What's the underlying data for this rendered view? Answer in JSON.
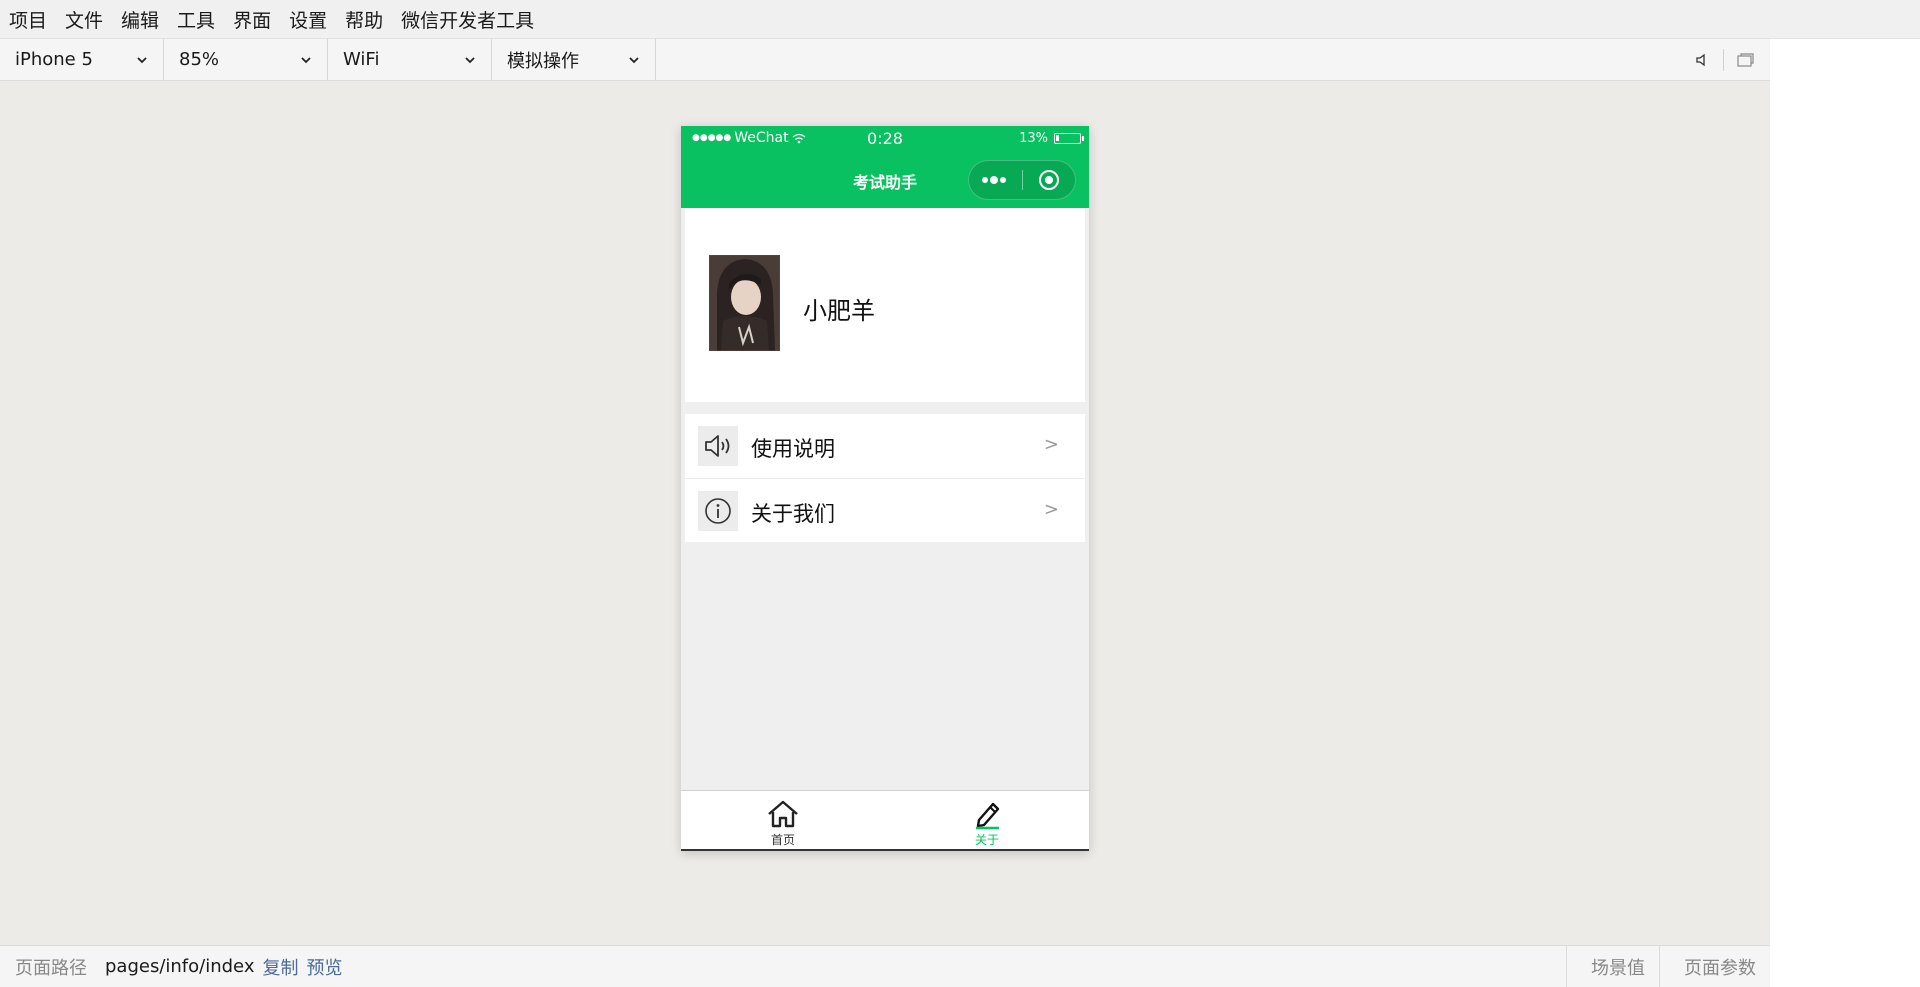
{
  "menubar": {
    "items": [
      "项目",
      "文件",
      "编辑",
      "工具",
      "界面",
      "设置",
      "帮助",
      "微信开发者工具"
    ]
  },
  "toolbar": {
    "device": "iPhone 5",
    "zoom": "85%",
    "network": "WiFi",
    "operation": "模拟操作",
    "icons": [
      "speaker-icon",
      "window-icon"
    ]
  },
  "phone": {
    "statusbar": {
      "signal": "●●●●●",
      "carrier": "WeChat",
      "time": "0:28",
      "battery": "13%",
      "battery_level": 0.13
    },
    "navbar": {
      "title": "考试助手",
      "capsule_icons": [
        "more-dots-icon",
        "close-target-icon"
      ]
    },
    "profile": {
      "username": "小肥羊"
    },
    "list": [
      {
        "icon": "speaker-icon",
        "label": "使用说明",
        "arrow": ">"
      },
      {
        "icon": "info-icon",
        "label": "关于我们",
        "arrow": ">"
      }
    ],
    "tabbar": [
      {
        "icon": "home-icon",
        "label": "首页",
        "active": false
      },
      {
        "icon": "edit-icon",
        "label": "关于",
        "active": true
      }
    ],
    "colors": {
      "brand": "#09c160"
    }
  },
  "pathbar": {
    "label": "页面路径",
    "path": "pages/info/index",
    "copy": "复制",
    "preview": "预览",
    "scene": "场景值",
    "params": "页面参数"
  }
}
